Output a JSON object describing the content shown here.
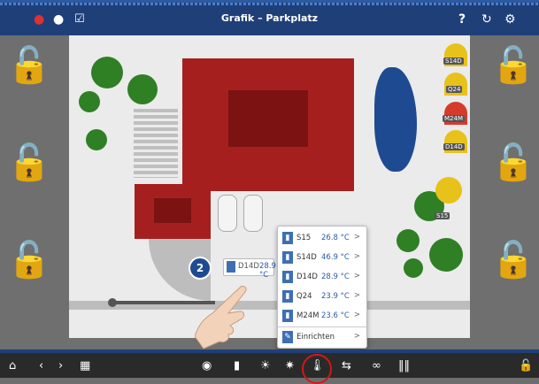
{
  "header": {
    "title": "Grafik – Parkplatz",
    "icons_left": [
      "alarm-icon",
      "chat-icon",
      "checkbox-icon"
    ],
    "icons_right": [
      "help-icon",
      "refresh-icon",
      "settings-icon"
    ],
    "help_label": "?"
  },
  "map": {
    "sensors": [
      {
        "label": "S14D"
      },
      {
        "label": "Q24"
      },
      {
        "label": "M24M"
      },
      {
        "label": "D14D"
      },
      {
        "label": "S15"
      }
    ]
  },
  "callout": {
    "badge": "2",
    "label": "D14D",
    "value": "28.9 °C"
  },
  "popup": {
    "rows": [
      {
        "label": "S15",
        "value": "26.8 °C"
      },
      {
        "label": "S14D",
        "value": "46.9 °C"
      },
      {
        "label": "D14D",
        "value": "28.9 °C"
      },
      {
        "label": "Q24",
        "value": "23.9 °C"
      },
      {
        "label": "M24M",
        "value": "23.6 °C"
      }
    ],
    "setup_label": "Einrichten",
    "arrow": ">"
  },
  "footer": {
    "icons": [
      "home-icon",
      "back-icon",
      "forward-icon",
      "grid-icon",
      "camera-icon",
      "door-icon",
      "light-icon",
      "dimmer-icon",
      "thermometer-icon",
      "shutter-icon",
      "link-icon",
      "blinds-icon",
      "lock-icon"
    ]
  },
  "colors": {
    "topbar": "#1f3f78",
    "roof": "#a61f1f",
    "tree": "#2f7f25",
    "water": "#1e4a91",
    "accent": "#e8c21a"
  }
}
